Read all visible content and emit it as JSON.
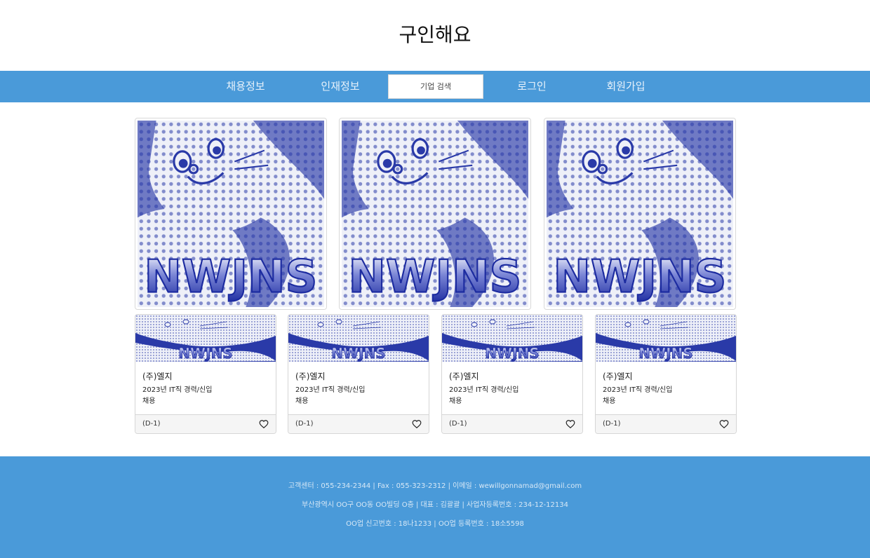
{
  "site": {
    "title": "구인해요"
  },
  "nav": {
    "items": [
      {
        "label": "채용정보"
      },
      {
        "label": "인재정보"
      },
      {
        "label": "기업 검색"
      },
      {
        "label": "로그인"
      },
      {
        "label": "회원가입"
      }
    ]
  },
  "banners": [
    {
      "image": "nwjns-bunny-art"
    },
    {
      "image": "nwjns-bunny-art"
    },
    {
      "image": "nwjns-bunny-art"
    }
  ],
  "cards": [
    {
      "company": "(주)엘지",
      "line1": "2023년 IT직 경력/신입",
      "line2": "채용",
      "dday": "(D-1)",
      "icon": "heart-icon"
    },
    {
      "company": "(주)엘지",
      "line1": "2023년 IT직 경력/신입",
      "line2": "채용",
      "dday": "(D-1)",
      "icon": "heart-icon"
    },
    {
      "company": "(주)엘지",
      "line1": "2023년 IT직 경력/신입",
      "line2": "채용",
      "dday": "(D-1)",
      "icon": "heart-icon"
    },
    {
      "company": "(주)엘지",
      "line1": "2023년 IT직 경력/신입",
      "line2": "채용",
      "dday": "(D-1)",
      "icon": "heart-icon"
    }
  ],
  "footer": {
    "line1": "고객센터 : 055-234-2344 | Fax : 055-323-2312 | 이메일 : wewillgonnamad@gmail.com",
    "line2": "부산광역시 OO구 OO동 OO빌딩 O층 | 대표 : 김괄괄 | 사업자등록번호 : 234-12-12134",
    "line3": "OO업 신고번호 : 18나1233 | OO업 등록번호 : 18소5598"
  },
  "colors": {
    "brand_blue": "#4a9ad9",
    "art_blue": "#2a3aa8"
  }
}
